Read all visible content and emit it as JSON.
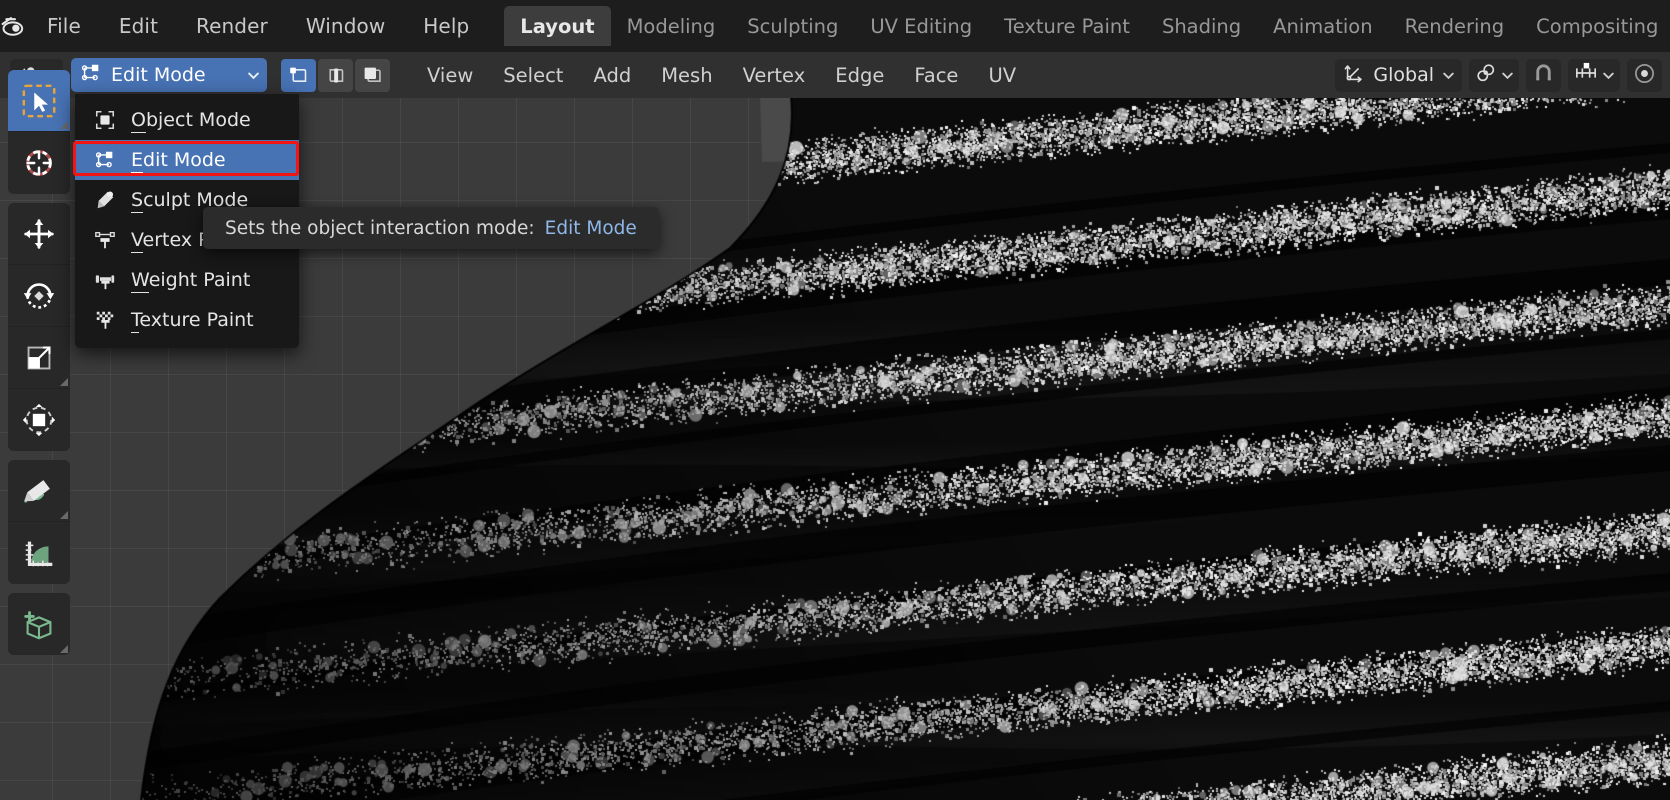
{
  "app": {
    "name": "Blender",
    "logo_icon": "blender-logo-icon"
  },
  "topbar": {
    "menus": [
      {
        "label": "File"
      },
      {
        "label": "Edit"
      },
      {
        "label": "Render"
      },
      {
        "label": "Window"
      },
      {
        "label": "Help"
      }
    ],
    "workspace_tabs": [
      {
        "label": "Layout",
        "active": true
      },
      {
        "label": "Modeling",
        "active": false
      },
      {
        "label": "Sculpting",
        "active": false
      },
      {
        "label": "UV Editing",
        "active": false
      },
      {
        "label": "Texture Paint",
        "active": false
      },
      {
        "label": "Shading",
        "active": false
      },
      {
        "label": "Animation",
        "active": false
      },
      {
        "label": "Rendering",
        "active": false
      },
      {
        "label": "Compositing",
        "active": false
      }
    ]
  },
  "viewport_header": {
    "editor_type_icon": "editor-type-3d-viewport-icon",
    "mode_selector": {
      "value": "Edit Mode",
      "icon": "edit-mode-icon",
      "chevron": "chevron-down-icon",
      "expanded": true
    },
    "select_modes": [
      {
        "name": "vertex-select",
        "icon": "vertex-select-icon",
        "active": true
      },
      {
        "name": "edge-select",
        "icon": "edge-select-icon",
        "active": false
      },
      {
        "name": "face-select",
        "icon": "face-select-icon",
        "active": false
      }
    ],
    "menus": [
      {
        "label": "View"
      },
      {
        "label": "Select"
      },
      {
        "label": "Add"
      },
      {
        "label": "Mesh"
      },
      {
        "label": "Vertex"
      },
      {
        "label": "Edge"
      },
      {
        "label": "Face"
      },
      {
        "label": "UV"
      }
    ],
    "transform_orientation": {
      "label": "Global",
      "icon": "transform-orientation-icon",
      "chevron": "chevron-down-icon"
    },
    "pivot_point": {
      "icon": "pivot-point-icon",
      "chevron": "chevron-down-icon"
    },
    "snap_magnet": {
      "icon": "snap-magnet-icon",
      "enabled": false
    },
    "snap_to": {
      "icon": "snap-increment-icon",
      "chevron": "chevron-down-icon"
    },
    "proportional_editing": {
      "icon": "proportional-editing-icon",
      "enabled": false
    }
  },
  "mode_dropdown": {
    "items": [
      {
        "label": "Object Mode",
        "accel": "O",
        "icon": "object-mode-icon",
        "selected": false
      },
      {
        "label": "Edit Mode",
        "accel": "E",
        "icon": "edit-mode-icon",
        "selected": true
      },
      {
        "label": "Sculpt Mode",
        "accel": "S",
        "icon": "sculpt-mode-icon",
        "selected": false
      },
      {
        "label": "Vertex Paint",
        "accel": "V",
        "icon": "vertex-paint-icon",
        "selected": false
      },
      {
        "label": "Weight Paint",
        "accel": "W",
        "icon": "weight-paint-icon",
        "selected": false
      },
      {
        "label": "Texture Paint",
        "accel": "T",
        "icon": "texture-paint-icon",
        "selected": false
      }
    ],
    "highlight_color": "#f31414",
    "selected_color": "#4772b3"
  },
  "tooltip": {
    "text": "Sets the object interaction mode:",
    "value": "Edit Mode"
  },
  "toolbar": {
    "groups": [
      {
        "tools": [
          {
            "name": "tweak-select-box-tool",
            "icon": "select-box-icon",
            "active": true,
            "has_submenu": true
          },
          {
            "name": "cursor-tool",
            "icon": "cursor-3d-icon",
            "active": false,
            "has_submenu": false
          }
        ]
      },
      {
        "tools": [
          {
            "name": "move-tool",
            "icon": "move-icon",
            "active": false,
            "has_submenu": false
          },
          {
            "name": "rotate-tool",
            "icon": "rotate-icon",
            "active": false,
            "has_submenu": false
          },
          {
            "name": "scale-tool",
            "icon": "scale-icon",
            "active": false,
            "has_submenu": true
          },
          {
            "name": "transform-tool",
            "icon": "transform-icon",
            "active": false,
            "has_submenu": false
          }
        ]
      },
      {
        "tools": [
          {
            "name": "annotate-tool",
            "icon": "annotate-pencil-icon",
            "active": false,
            "has_submenu": true
          },
          {
            "name": "measure-tool",
            "icon": "measure-ruler-icon",
            "active": false,
            "has_submenu": false
          }
        ]
      },
      {
        "tools": [
          {
            "name": "add-cube-tool",
            "icon": "add-cube-icon",
            "active": false,
            "has_submenu": true
          }
        ]
      }
    ]
  },
  "viewport": {
    "background_color": "#3b3b3b",
    "object_description": "dense black mesh in edit mode with white vertices"
  }
}
